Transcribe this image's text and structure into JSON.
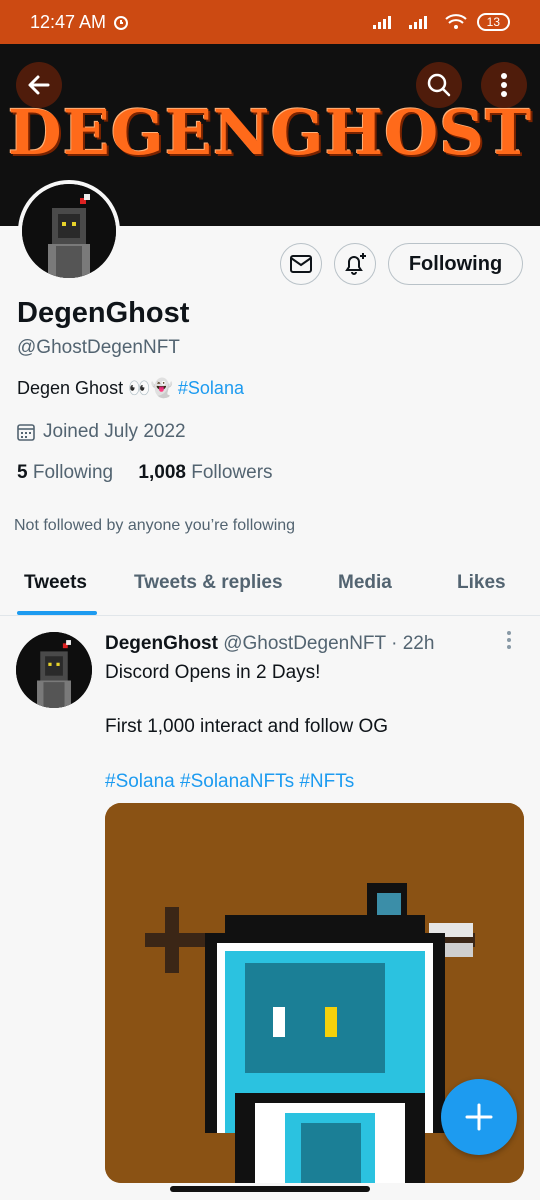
{
  "status_bar": {
    "time": "12:47 AM",
    "battery": "13"
  },
  "banner": {
    "title": "DEGENGHOST"
  },
  "profile": {
    "display_name": "DegenGhost",
    "handle": "@GhostDegenNFT",
    "bio_text": "Degen Ghost 👀👻 ",
    "bio_hashtag": "#Solana",
    "joined": "Joined July 2022",
    "following_count": "5",
    "following_label": "Following",
    "followers_count": "1,008",
    "followers_label": "Followers",
    "not_followed": "Not followed by anyone you’re following",
    "follow_button_label": "Following"
  },
  "tabs": [
    {
      "label": "Tweets",
      "active": true
    },
    {
      "label": "Tweets & replies",
      "active": false
    },
    {
      "label": "Media",
      "active": false
    },
    {
      "label": "Likes",
      "active": false
    }
  ],
  "tweet": {
    "name": "DegenGhost",
    "handle": "@GhostDegenNFT",
    "separator": "·",
    "time": "22h",
    "line1": "Discord Opens in 2 Days!",
    "line2": "First 1,000 interact and follow OG",
    "hashtags": "#Solana #SolanaNFTs #NFTs"
  },
  "icons": {
    "back": "back-arrow-icon",
    "search": "search-icon",
    "more": "more-vertical-icon",
    "message": "envelope-icon",
    "notify": "bell-plus-icon",
    "calendar": "calendar-icon",
    "compose": "plus-icon"
  },
  "colors": {
    "accent": "#1d9bf0",
    "status_bar": "#cc4a12",
    "banner_text": "#ff6a1a"
  }
}
